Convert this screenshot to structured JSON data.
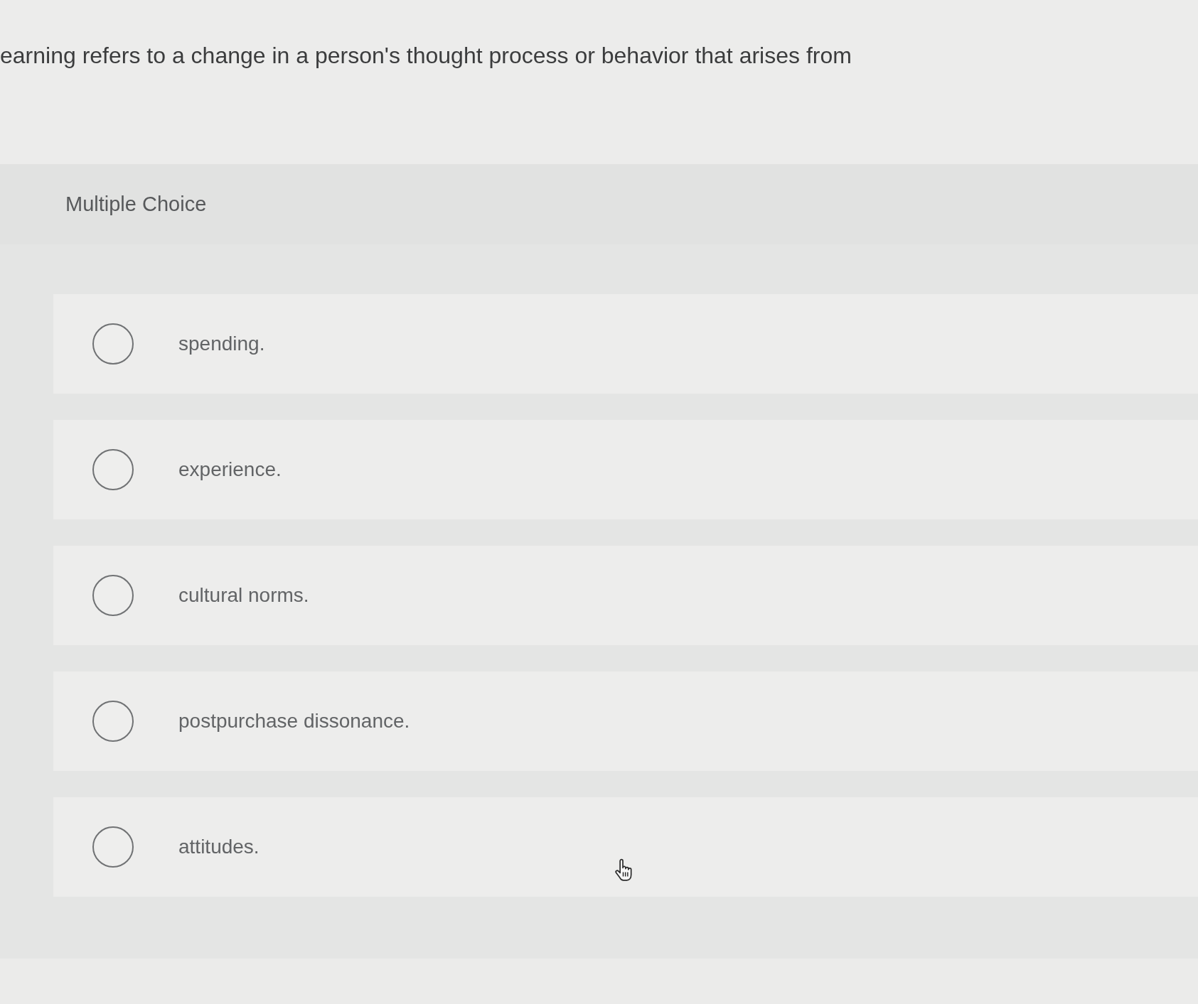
{
  "question": {
    "text": "earning refers to a change in a person's thought process or behavior that arises from"
  },
  "question_type": "Multiple Choice",
  "options": [
    {
      "label": "spending.",
      "selected": false
    },
    {
      "label": "experience.",
      "selected": false
    },
    {
      "label": "cultural norms.",
      "selected": false
    },
    {
      "label": "postpurchase dissonance.",
      "selected": false
    },
    {
      "label": "attitudes.",
      "selected": false
    }
  ]
}
